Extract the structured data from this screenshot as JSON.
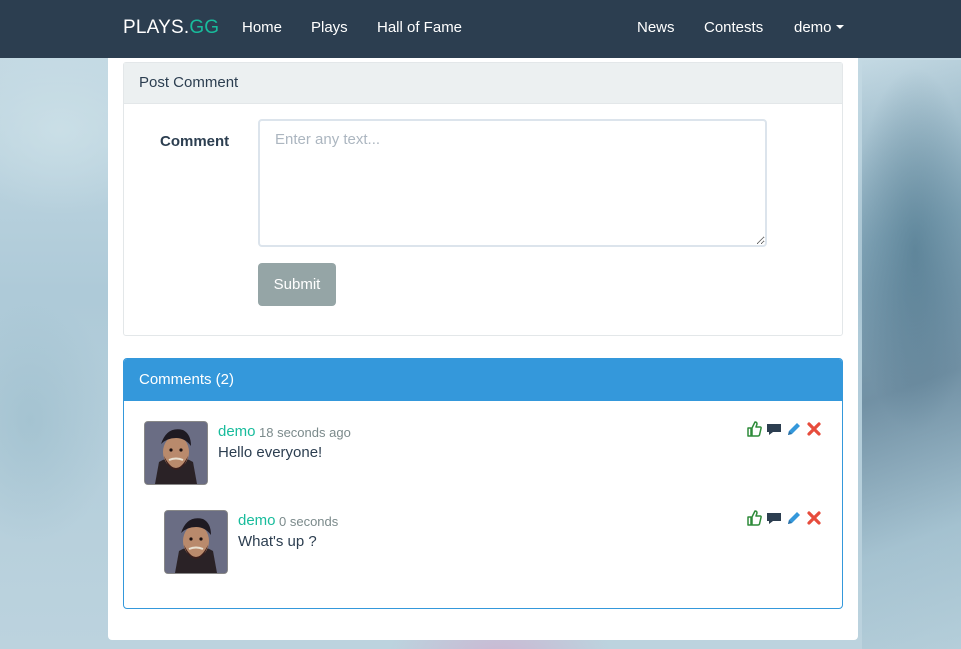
{
  "navbar": {
    "brand_main": "PLAYS.",
    "brand_accent": "GG",
    "links": [
      "Home",
      "Plays",
      "Hall of Fame"
    ],
    "right_links": [
      "News",
      "Contests"
    ],
    "user_menu": "demo"
  },
  "post_comment": {
    "title": "Post Comment",
    "label": "Comment",
    "placeholder": "Enter any text...",
    "submit_label": "Submit"
  },
  "comments_panel": {
    "title": "Comments (2)",
    "comments": [
      {
        "author": "demo",
        "time": "18 seconds ago",
        "text": "Hello everyone!"
      },
      {
        "author": "demo",
        "time": "0 seconds",
        "text": "What's up ?"
      }
    ]
  },
  "icons": {
    "like": "thumbs-up-icon",
    "reply": "comment-bubble-icon",
    "edit": "pencil-icon",
    "delete": "close-icon"
  },
  "colors": {
    "navbar": "#2c3e50",
    "accent_green": "#18bc9c",
    "panel_blue": "#3498db",
    "submit_gray": "#95a5a6",
    "delete_red": "#e74c3c"
  }
}
